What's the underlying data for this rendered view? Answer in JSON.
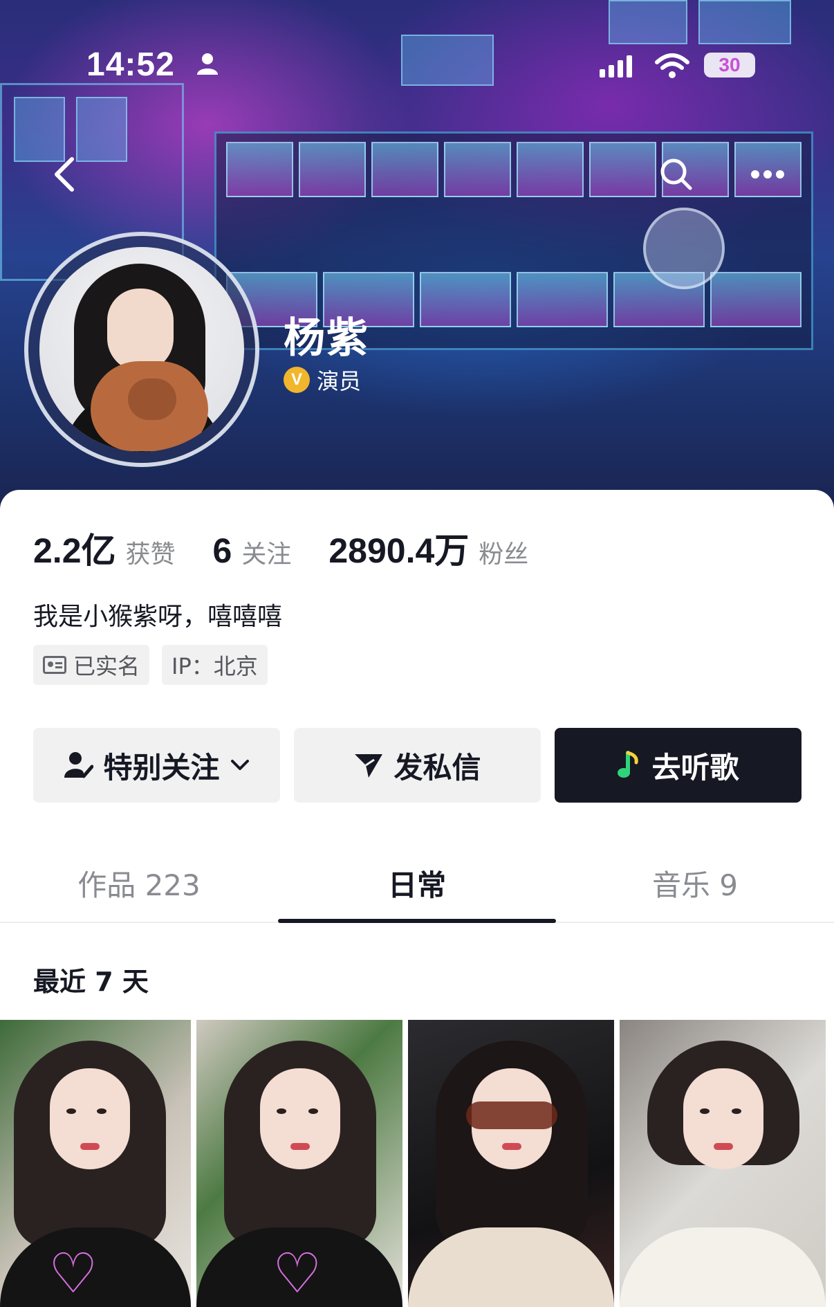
{
  "status_bar": {
    "time": "14:52",
    "battery": "30"
  },
  "profile": {
    "name": "杨紫",
    "badge_label": "演员",
    "stats": [
      {
        "value": "2.2亿",
        "label": "获赞"
      },
      {
        "value": "6",
        "label": "关注"
      },
      {
        "value": "2890.4万",
        "label": "粉丝"
      }
    ],
    "bio": "我是小猴紫呀，嘻嘻嘻",
    "tags": {
      "verified": "已实名",
      "ip": "IP：北京"
    }
  },
  "actions": {
    "follow_label": "特别关注",
    "message_label": "发私信",
    "music_label": "去听歌"
  },
  "tabs": [
    {
      "label": "作品 223"
    },
    {
      "label": "日常",
      "active": true
    },
    {
      "label": "音乐 9"
    }
  ],
  "section_title": "最近 7 天",
  "colors": {
    "accent_dark": "#161823",
    "badge_gold": "#f1b62c",
    "music_green": "#2fd37a"
  },
  "icons": [
    "back-arrow-icon",
    "search-icon",
    "more-icon",
    "verified-v-icon",
    "id-card-icon",
    "person-check-icon",
    "chevron-down-icon",
    "send-icon",
    "music-note-icon"
  ]
}
